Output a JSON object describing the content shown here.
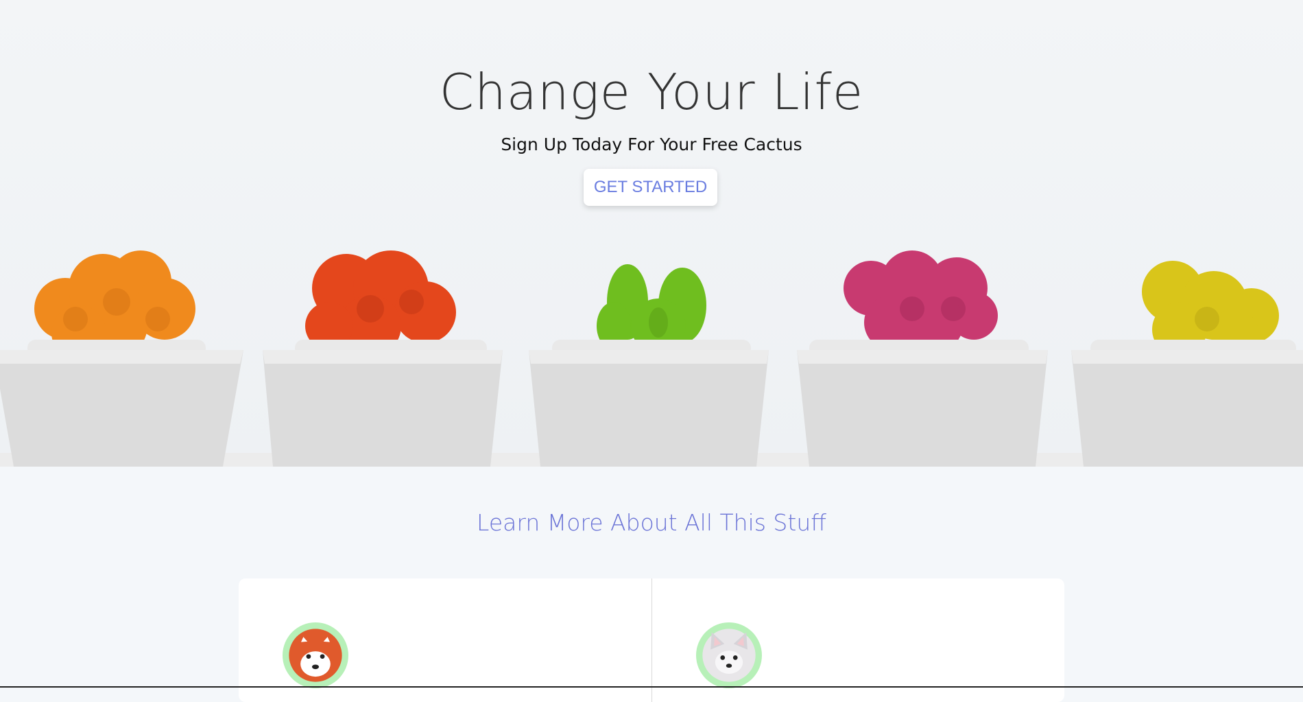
{
  "hero": {
    "title": "Change Your Life",
    "subtitle": "Sign Up Today For Your Free Cactus",
    "cta_label": "GET STARTED",
    "image": {
      "icon": "cactus-pots-photo",
      "cactus_colors": [
        "#f08a1d",
        "#e4471c",
        "#6fbe1f",
        "#c83a70",
        "#d9c51a"
      ]
    }
  },
  "learn": {
    "title": "Learn More About All This Stuff"
  },
  "cards": [
    {
      "avatar_icon": "red-panda-icon"
    },
    {
      "avatar_icon": "chihuahua-icon"
    }
  ],
  "colors": {
    "accent": "#6a73d6",
    "avatar_ring": "#b7f0b8"
  }
}
